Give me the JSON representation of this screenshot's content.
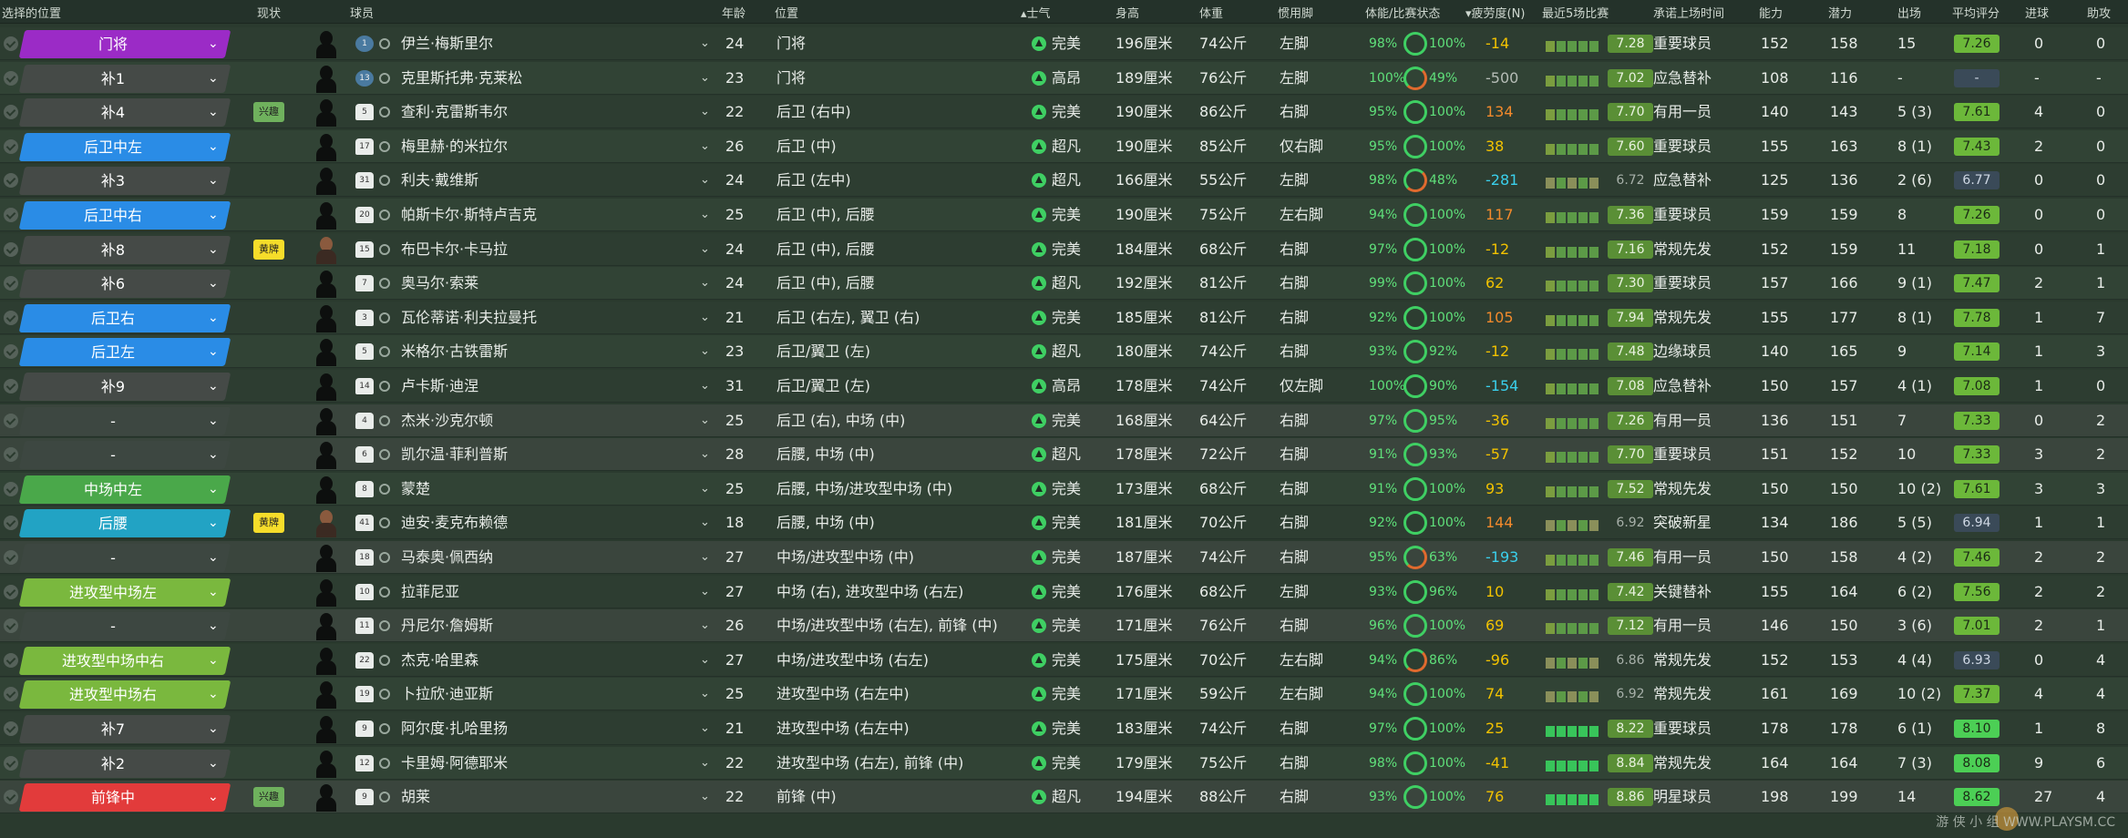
{
  "headers": {
    "selected_position": "选择的位置",
    "status": "现状",
    "player": "球员",
    "age": "年龄",
    "position": "位置",
    "morale": "士气",
    "height": "身高",
    "weight": "体重",
    "foot": "惯用脚",
    "condition": "体能/比赛状态",
    "fatigue": "疲劳度(N)",
    "last5": "最近5场比赛",
    "playing_time": "承诺上场时间",
    "ability": "能力",
    "potential": "潜力",
    "apps": "出场",
    "avg_rating": "平均评分",
    "goals": "进球",
    "assists": "助攻"
  },
  "players": [
    {
      "sel": "门将",
      "sel_type": "gk",
      "tag": "",
      "num": "1",
      "name": "伊兰·梅斯里尔",
      "age": "24",
      "pos": "门将",
      "morale": "完美",
      "height": "196厘米",
      "weight": "74公斤",
      "foot": "左脚",
      "fit": "98%",
      "match": "100%",
      "fatigue": "-14",
      "fatigue_color": "#f2c200",
      "form": "7.28",
      "time": "重要球员",
      "ca": "152",
      "pa": "158",
      "apps": "15",
      "avg": "7.26",
      "goals": "0",
      "assists": "0"
    },
    {
      "sel": "补1",
      "sel_type": "sub",
      "tag": "",
      "num": "13",
      "name": "克里斯托弗·克莱松",
      "age": "23",
      "pos": "门将",
      "morale": "高昂",
      "height": "189厘米",
      "weight": "76公斤",
      "foot": "左脚",
      "fit": "100%",
      "match": "49%",
      "fatigue": "-500",
      "fatigue_color": "#b6bdb7",
      "form": "7.02",
      "time": "应急替补",
      "ca": "108",
      "pa": "116",
      "apps": "-",
      "avg": "-",
      "goals": "-",
      "assists": "-"
    },
    {
      "sel": "补4",
      "sel_type": "sub",
      "tag": "兴趣",
      "num": "5",
      "name": "查利·克雷斯韦尔",
      "age": "22",
      "pos": "后卫 (右中)",
      "morale": "完美",
      "height": "190厘米",
      "weight": "86公斤",
      "foot": "右脚",
      "fit": "95%",
      "match": "100%",
      "fatigue": "134",
      "fatigue_color": "#f28a2c",
      "form": "7.70",
      "time": "有用一员",
      "ca": "140",
      "pa": "143",
      "apps": "5 (3)",
      "avg": "7.61",
      "goals": "4",
      "assists": "0"
    },
    {
      "sel": "后卫中左",
      "sel_type": "def",
      "tag": "",
      "num": "17",
      "name": "梅里赫·的米拉尔",
      "age": "26",
      "pos": "后卫 (中)",
      "morale": "超凡",
      "height": "190厘米",
      "weight": "85公斤",
      "foot": "仅右脚",
      "fit": "95%",
      "match": "100%",
      "fatigue": "38",
      "fatigue_color": "#f2c200",
      "form": "7.60",
      "time": "重要球员",
      "ca": "155",
      "pa": "163",
      "apps": "8 (1)",
      "avg": "7.43",
      "goals": "2",
      "assists": "0"
    },
    {
      "sel": "补3",
      "sel_type": "sub",
      "tag": "",
      "num": "31",
      "name": "利夫·戴维斯",
      "age": "24",
      "pos": "后卫 (左中)",
      "morale": "超凡",
      "height": "166厘米",
      "weight": "55公斤",
      "foot": "左脚",
      "fit": "98%",
      "match": "48%",
      "fatigue": "-281",
      "fatigue_color": "#3ad0ec",
      "form": "6.72",
      "time": "应急替补",
      "ca": "125",
      "pa": "136",
      "apps": "2 (6)",
      "avg": "6.77",
      "goals": "0",
      "assists": "0"
    },
    {
      "sel": "后卫中右",
      "sel_type": "def",
      "tag": "",
      "num": "20",
      "name": "帕斯卡尔·斯特卢吉克",
      "age": "25",
      "pos": "后卫 (中), 后腰",
      "morale": "完美",
      "height": "190厘米",
      "weight": "75公斤",
      "foot": "左右脚",
      "fit": "94%",
      "match": "100%",
      "fatigue": "117",
      "fatigue_color": "#f28a2c",
      "form": "7.36",
      "time": "重要球员",
      "ca": "159",
      "pa": "159",
      "apps": "8",
      "avg": "7.26",
      "goals": "0",
      "assists": "0"
    },
    {
      "sel": "补8",
      "sel_type": "sub",
      "tag": "黄牌",
      "num": "15",
      "name": "布巴卡尔·卡马拉",
      "age": "24",
      "pos": "后卫 (中), 后腰",
      "morale": "完美",
      "height": "184厘米",
      "weight": "68公斤",
      "foot": "右脚",
      "fit": "97%",
      "match": "100%",
      "fatigue": "-12",
      "fatigue_color": "#f2c200",
      "form": "7.16",
      "time": "常规先发",
      "ca": "152",
      "pa": "159",
      "apps": "11",
      "avg": "7.18",
      "goals": "0",
      "assists": "1"
    },
    {
      "sel": "补6",
      "sel_type": "sub",
      "tag": "",
      "num": "7",
      "name": "奥马尔·索莱",
      "age": "24",
      "pos": "后卫 (中), 后腰",
      "morale": "超凡",
      "height": "192厘米",
      "weight": "81公斤",
      "foot": "右脚",
      "fit": "99%",
      "match": "100%",
      "fatigue": "62",
      "fatigue_color": "#f2c200",
      "form": "7.30",
      "time": "重要球员",
      "ca": "157",
      "pa": "166",
      "apps": "9 (1)",
      "avg": "7.47",
      "goals": "2",
      "assists": "1"
    },
    {
      "sel": "后卫右",
      "sel_type": "def",
      "tag": "",
      "num": "3",
      "name": "瓦伦蒂诺·利夫拉曼托",
      "age": "21",
      "pos": "后卫 (右左), 翼卫 (右)",
      "morale": "完美",
      "height": "185厘米",
      "weight": "81公斤",
      "foot": "右脚",
      "fit": "92%",
      "match": "100%",
      "fatigue": "105",
      "fatigue_color": "#f28a2c",
      "form": "7.94",
      "time": "常规先发",
      "ca": "155",
      "pa": "177",
      "apps": "8 (1)",
      "avg": "7.78",
      "goals": "1",
      "assists": "7"
    },
    {
      "sel": "后卫左",
      "sel_type": "def",
      "tag": "",
      "num": "5",
      "name": "米格尔·古铁雷斯",
      "age": "23",
      "pos": "后卫/翼卫 (左)",
      "morale": "超凡",
      "height": "180厘米",
      "weight": "74公斤",
      "foot": "右脚",
      "fit": "93%",
      "match": "92%",
      "fatigue": "-12",
      "fatigue_color": "#f2c200",
      "form": "7.48",
      "time": "边缘球员",
      "ca": "140",
      "pa": "165",
      "apps": "9",
      "avg": "7.14",
      "goals": "1",
      "assists": "3"
    },
    {
      "sel": "补9",
      "sel_type": "sub",
      "tag": "",
      "num": "14",
      "name": "卢卡斯·迪涅",
      "age": "31",
      "pos": "后卫/翼卫 (左)",
      "morale": "高昂",
      "height": "178厘米",
      "weight": "74公斤",
      "foot": "仅左脚",
      "fit": "100%",
      "match": "90%",
      "fatigue": "-154",
      "fatigue_color": "#3ad0ec",
      "form": "7.08",
      "time": "应急替补",
      "ca": "150",
      "pa": "157",
      "apps": "4 (1)",
      "avg": "7.08",
      "goals": "1",
      "assists": "0"
    },
    {
      "sel": "-",
      "sel_type": "none",
      "tag": "",
      "num": "4",
      "name": "杰米·沙克尔顿",
      "age": "25",
      "pos": "后卫 (右), 中场 (中)",
      "morale": "完美",
      "height": "168厘米",
      "weight": "64公斤",
      "foot": "右脚",
      "fit": "97%",
      "match": "95%",
      "fatigue": "-36",
      "fatigue_color": "#f2c200",
      "form": "7.26",
      "time": "有用一员",
      "ca": "136",
      "pa": "151",
      "apps": "7",
      "avg": "7.33",
      "goals": "0",
      "assists": "2"
    },
    {
      "sel": "-",
      "sel_type": "none",
      "tag": "",
      "num": "6",
      "name": "凯尔温·菲利普斯",
      "age": "28",
      "pos": "后腰, 中场 (中)",
      "morale": "超凡",
      "height": "178厘米",
      "weight": "72公斤",
      "foot": "右脚",
      "fit": "91%",
      "match": "93%",
      "fatigue": "-57",
      "fatigue_color": "#f2c200",
      "form": "7.70",
      "time": "重要球员",
      "ca": "151",
      "pa": "152",
      "apps": "10",
      "avg": "7.33",
      "goals": "3",
      "assists": "2"
    },
    {
      "sel": "中场中左",
      "sel_type": "mid",
      "tag": "",
      "num": "8",
      "name": "蒙楚",
      "age": "25",
      "pos": "后腰, 中场/进攻型中场 (中)",
      "morale": "完美",
      "height": "173厘米",
      "weight": "68公斤",
      "foot": "右脚",
      "fit": "91%",
      "match": "100%",
      "fatigue": "93",
      "fatigue_color": "#f2c200",
      "form": "7.52",
      "time": "常规先发",
      "ca": "150",
      "pa": "150",
      "apps": "10 (2)",
      "avg": "7.61",
      "goals": "3",
      "assists": "3"
    },
    {
      "sel": "后腰",
      "sel_type": "dm",
      "tag": "黄牌",
      "num": "41",
      "name": "迪安·麦克布赖德",
      "age": "18",
      "pos": "后腰, 中场 (中)",
      "morale": "完美",
      "height": "181厘米",
      "weight": "70公斤",
      "foot": "右脚",
      "fit": "92%",
      "match": "100%",
      "fatigue": "144",
      "fatigue_color": "#f28a2c",
      "form": "6.92",
      "time": "突破新星",
      "ca": "134",
      "pa": "186",
      "apps": "5 (5)",
      "avg": "6.94",
      "goals": "1",
      "assists": "1"
    },
    {
      "sel": "-",
      "sel_type": "none",
      "tag": "",
      "num": "18",
      "name": "马泰奥·佩西纳",
      "age": "27",
      "pos": "中场/进攻型中场 (中)",
      "morale": "完美",
      "height": "187厘米",
      "weight": "74公斤",
      "foot": "右脚",
      "fit": "95%",
      "match": "63%",
      "fatigue": "-193",
      "fatigue_color": "#3ad0ec",
      "form": "7.46",
      "time": "有用一员",
      "ca": "150",
      "pa": "158",
      "apps": "4 (2)",
      "avg": "7.46",
      "goals": "2",
      "assists": "2"
    },
    {
      "sel": "进攻型中场左",
      "sel_type": "am",
      "tag": "",
      "num": "10",
      "name": "拉菲尼亚",
      "age": "27",
      "pos": "中场 (右), 进攻型中场 (右左)",
      "morale": "完美",
      "height": "176厘米",
      "weight": "68公斤",
      "foot": "左脚",
      "fit": "93%",
      "match": "96%",
      "fatigue": "10",
      "fatigue_color": "#f2c200",
      "form": "7.42",
      "time": "关键替补",
      "ca": "155",
      "pa": "164",
      "apps": "6 (2)",
      "avg": "7.56",
      "goals": "2",
      "assists": "2"
    },
    {
      "sel": "-",
      "sel_type": "none",
      "tag": "",
      "num": "11",
      "name": "丹尼尔·詹姆斯",
      "age": "26",
      "pos": "中场/进攻型中场 (右左), 前锋 (中)",
      "morale": "完美",
      "height": "171厘米",
      "weight": "76公斤",
      "foot": "右脚",
      "fit": "96%",
      "match": "100%",
      "fatigue": "69",
      "fatigue_color": "#f2c200",
      "form": "7.12",
      "time": "有用一员",
      "ca": "146",
      "pa": "150",
      "apps": "3 (6)",
      "avg": "7.01",
      "goals": "2",
      "assists": "1"
    },
    {
      "sel": "进攻型中场中右",
      "sel_type": "am",
      "tag": "",
      "num": "22",
      "name": "杰克·哈里森",
      "age": "27",
      "pos": "中场/进攻型中场 (右左)",
      "morale": "完美",
      "height": "175厘米",
      "weight": "70公斤",
      "foot": "左右脚",
      "fit": "94%",
      "match": "86%",
      "fatigue": "-96",
      "fatigue_color": "#f2c200",
      "form": "6.86",
      "time": "常规先发",
      "ca": "152",
      "pa": "153",
      "apps": "4 (4)",
      "avg": "6.93",
      "goals": "0",
      "assists": "4"
    },
    {
      "sel": "进攻型中场右",
      "sel_type": "am",
      "tag": "",
      "num": "19",
      "name": "卜拉欣·迪亚斯",
      "age": "25",
      "pos": "进攻型中场 (右左中)",
      "morale": "完美",
      "height": "171厘米",
      "weight": "59公斤",
      "foot": "左右脚",
      "fit": "94%",
      "match": "100%",
      "fatigue": "74",
      "fatigue_color": "#f2c200",
      "form": "6.92",
      "time": "常规先发",
      "ca": "161",
      "pa": "169",
      "apps": "10 (2)",
      "avg": "7.37",
      "goals": "4",
      "assists": "4"
    },
    {
      "sel": "补7",
      "sel_type": "sub",
      "tag": "",
      "num": "9",
      "name": "阿尔度·扎哈里扬",
      "age": "21",
      "pos": "进攻型中场 (右左中)",
      "morale": "完美",
      "height": "183厘米",
      "weight": "74公斤",
      "foot": "右脚",
      "fit": "97%",
      "match": "100%",
      "fatigue": "25",
      "fatigue_color": "#f2c200",
      "form": "8.22",
      "time": "重要球员",
      "ca": "178",
      "pa": "178",
      "apps": "6 (1)",
      "avg": "8.10",
      "goals": "1",
      "assists": "8"
    },
    {
      "sel": "补2",
      "sel_type": "sub",
      "tag": "",
      "num": "12",
      "name": "卡里姆·阿德耶米",
      "age": "22",
      "pos": "进攻型中场 (右左), 前锋 (中)",
      "morale": "完美",
      "height": "179厘米",
      "weight": "75公斤",
      "foot": "右脚",
      "fit": "98%",
      "match": "100%",
      "fatigue": "-41",
      "fatigue_color": "#f2c200",
      "form": "8.84",
      "time": "常规先发",
      "ca": "164",
      "pa": "164",
      "apps": "7 (3)",
      "avg": "8.08",
      "goals": "9",
      "assists": "6"
    },
    {
      "sel": "前锋中",
      "sel_type": "st",
      "tag": "兴趣",
      "num": "9",
      "name": "胡莱",
      "age": "22",
      "pos": "前锋 (中)",
      "morale": "超凡",
      "height": "194厘米",
      "weight": "88公斤",
      "foot": "右脚",
      "fit": "93%",
      "match": "100%",
      "fatigue": "76",
      "fatigue_color": "#f2c200",
      "form": "8.86",
      "time": "明星球员",
      "ca": "198",
      "pa": "199",
      "apps": "14",
      "avg": "8.62",
      "goals": "27",
      "assists": "4"
    }
  ],
  "watermark": "游 侠 小 组  WWW.PLAYSM.CC"
}
